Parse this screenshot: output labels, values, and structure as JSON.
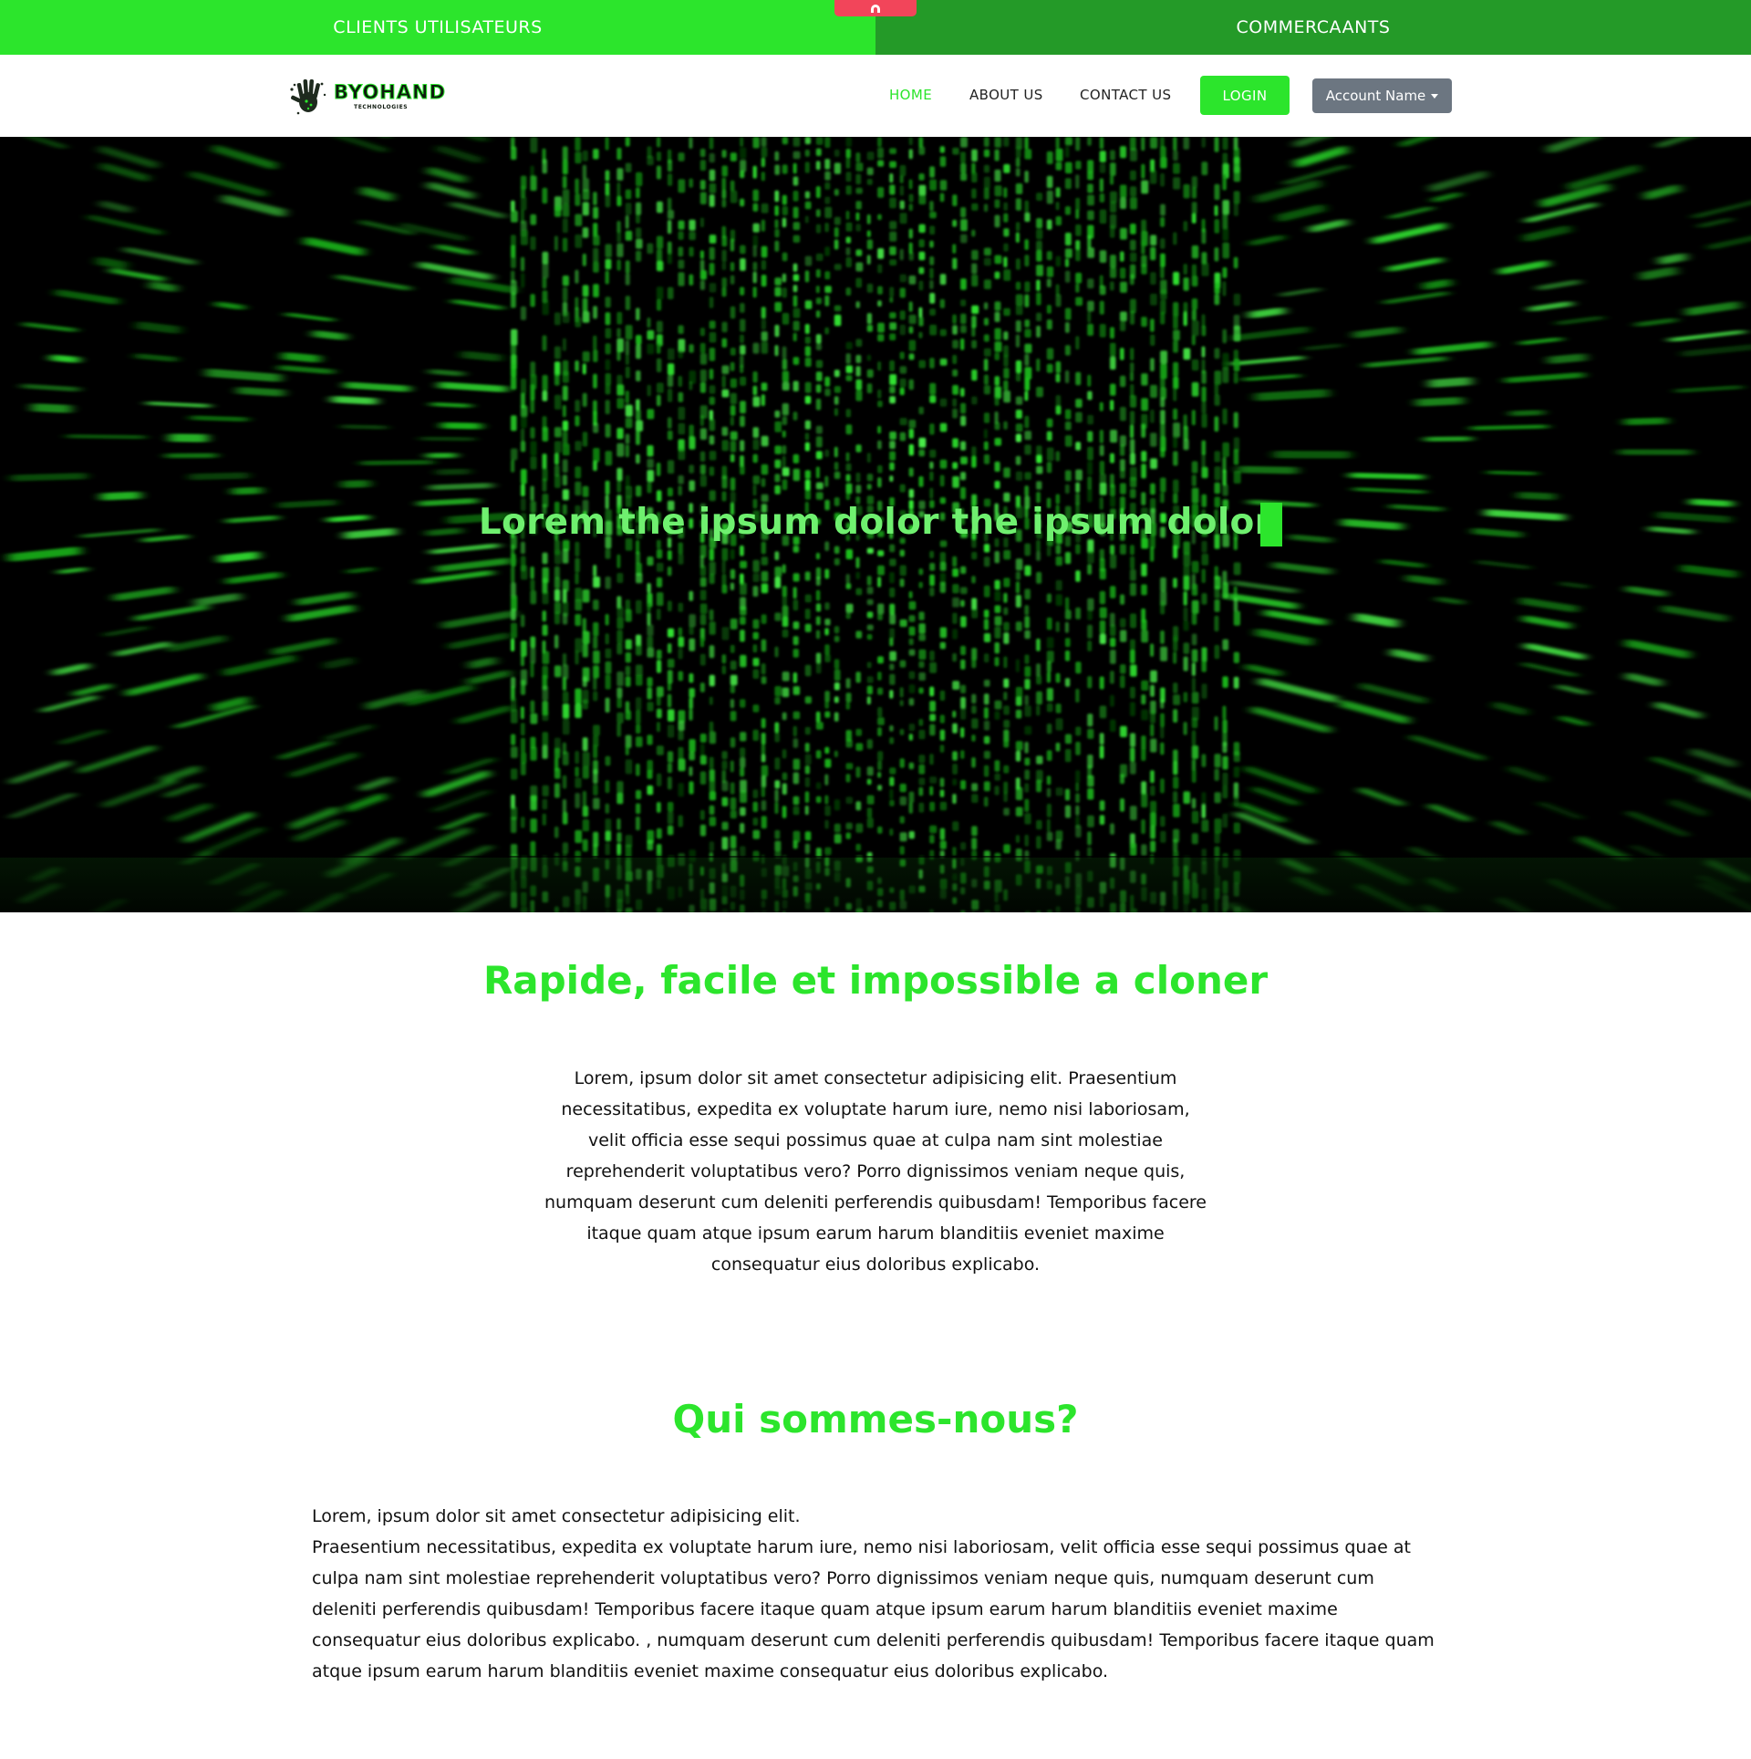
{
  "topbar": {
    "left_label": "CLIENTS UTILISATEURS",
    "right_label": "COMMERCAANTS"
  },
  "colors": {
    "accent": "#2ce52c",
    "accent_dark": "#249a28",
    "tab": "#f2455a",
    "account_button": "#6c7681"
  },
  "brand": {
    "logo_text": "BYOHAND",
    "logo_subtext": "TECHNOLOGIES"
  },
  "nav": {
    "home": "HOME",
    "about": "ABOUT US",
    "contact": "CONTACT US",
    "login": "LOGIN",
    "account": "Account Name"
  },
  "hero": {
    "title": "Lorem the ipsum dolor the ipsum dolor"
  },
  "section1": {
    "title": "Rapide, facile et impossible a cloner",
    "body": "Lorem, ipsum dolor sit amet consectetur adipisicing elit. Praesentium necessitatibus, expedita ex voluptate harum iure, nemo nisi laboriosam, velit officia esse sequi possimus quae at culpa nam sint molestiae reprehenderit voluptatibus vero? Porro dignissimos veniam neque quis, numquam deserunt cum deleniti perferendis quibusdam! Temporibus facere itaque quam atque ipsum earum harum blanditiis eveniet maxime consequatur eius doloribus explicabo."
  },
  "section2": {
    "title": "Qui sommes-nous?",
    "line1": "Lorem, ipsum dolor sit amet consectetur adipisicing elit.",
    "body": "Praesentium necessitatibus, expedita ex voluptate harum iure, nemo nisi laboriosam, velit officia esse sequi possimus quae at culpa nam sint molestiae reprehenderit voluptatibus vero? Porro dignissimos veniam neque quis, numquam deserunt cum deleniti perferendis quibusdam! Temporibus facere itaque quam atque ipsum earum harum blanditiis eveniet maxime consequatur eius doloribus explicabo. , numquam deserunt cum deleniti perferendis quibusdam! Temporibus facere itaque quam atque ipsum earum harum blanditiis eveniet maxime consequatur eius doloribus explicabo."
  }
}
